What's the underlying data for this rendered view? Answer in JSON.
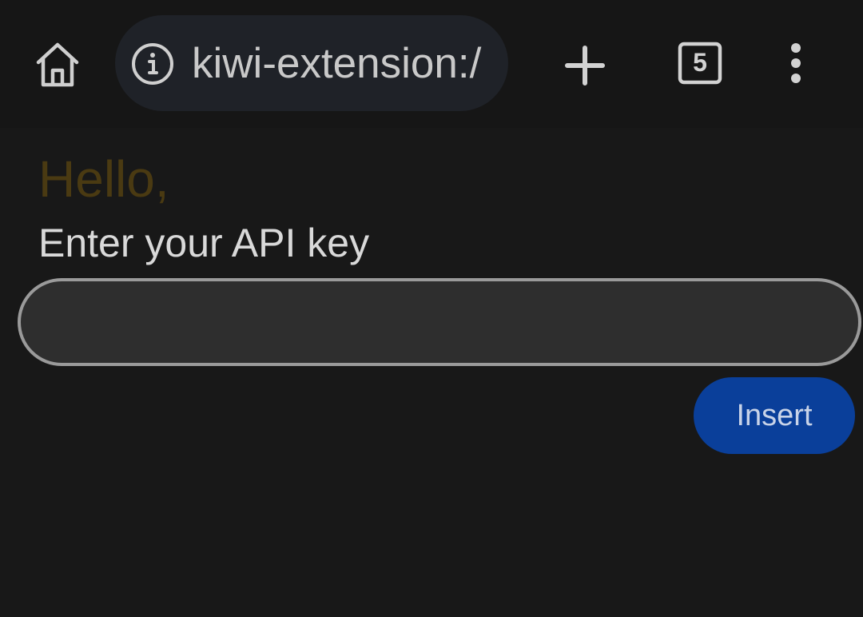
{
  "browser": {
    "url": "kiwi-extension:/",
    "tab_count": "5",
    "icons": {
      "home": "home-icon",
      "info": "info-icon",
      "new_tab": "plus-icon",
      "tabs": "tab-switcher-icon",
      "menu": "more-vert-icon"
    }
  },
  "page": {
    "greeting": "Hello,",
    "prompt": "Enter your API key",
    "api_key_value": "",
    "insert_label": "Insert"
  },
  "colors": {
    "background": "#181818",
    "greeting": "#4a3a12",
    "button": "#0a3f9a",
    "input_border": "#9a9a9a"
  }
}
